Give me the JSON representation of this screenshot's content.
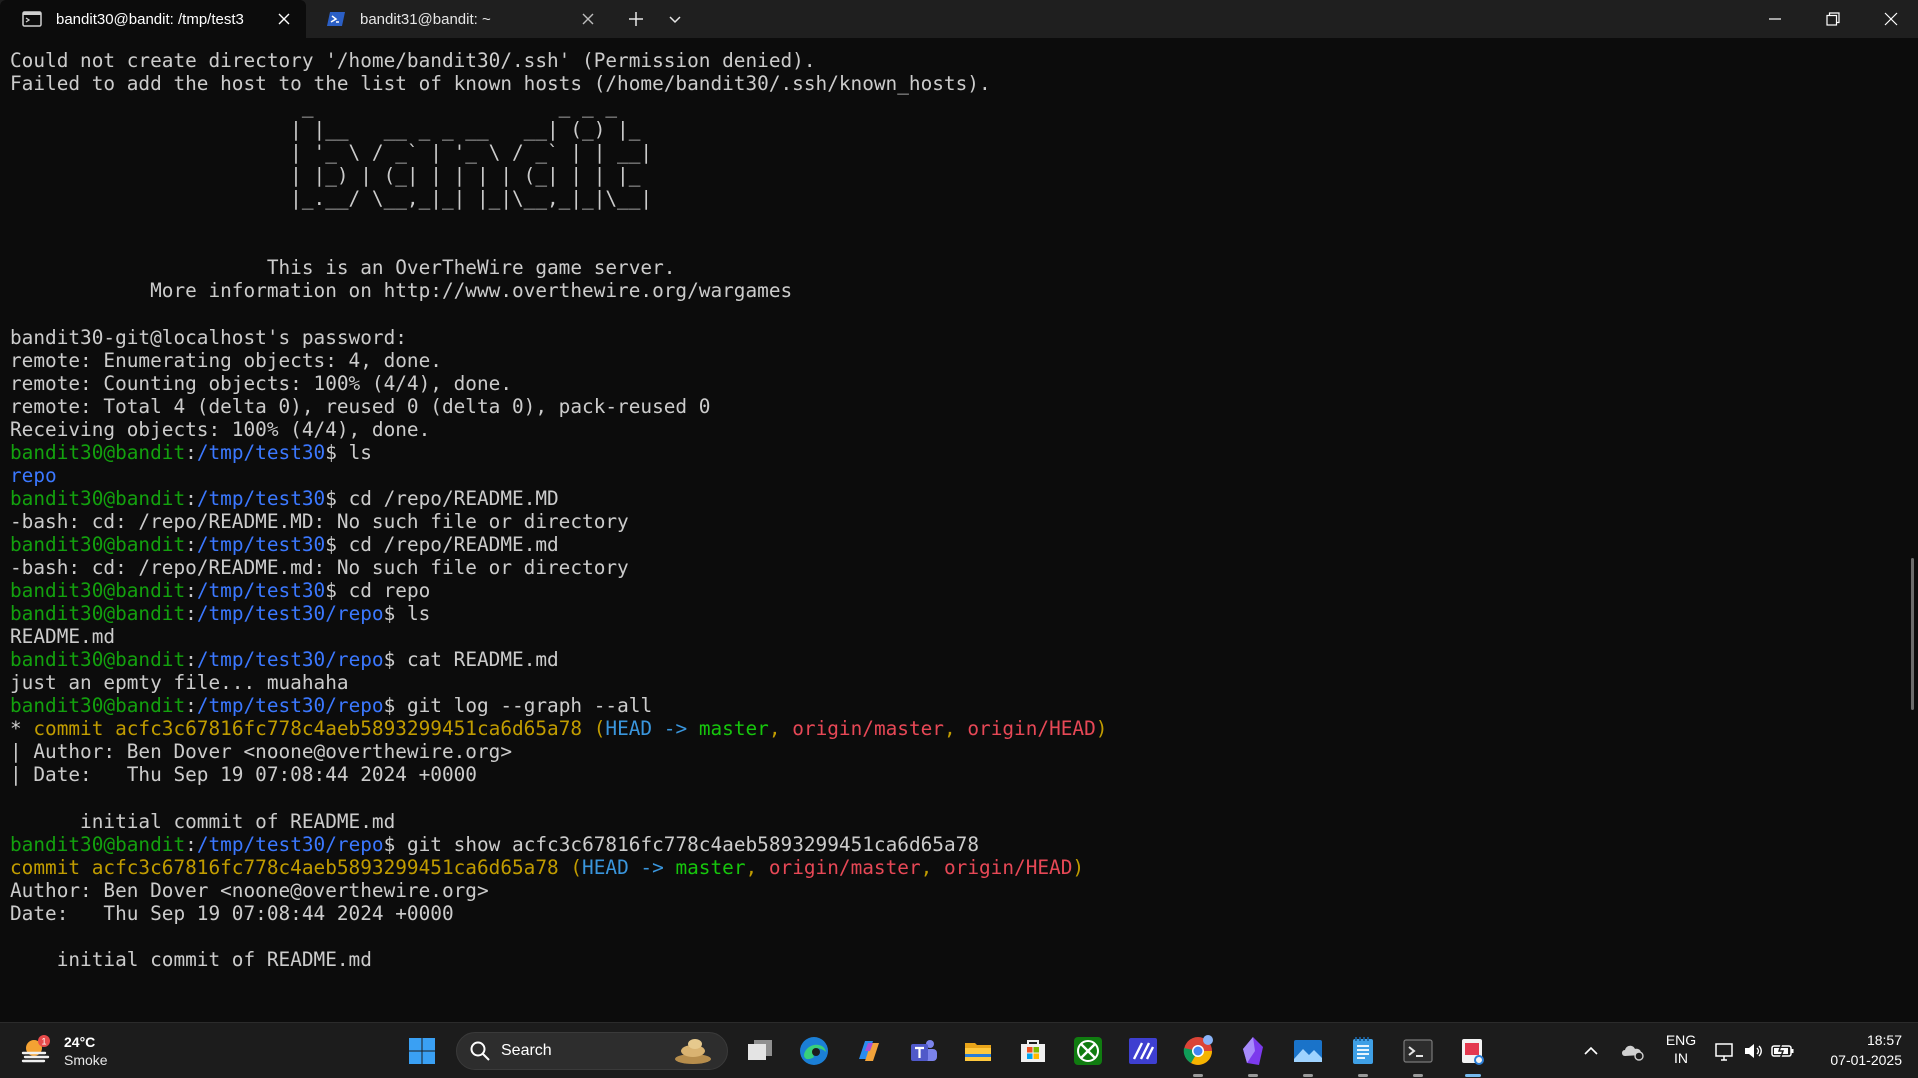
{
  "tabs": [
    {
      "title": "bandit30@bandit: /tmp/test3",
      "icon": "terminal-icon"
    },
    {
      "title": "bandit31@bandit: ~",
      "icon": "powershell-icon"
    }
  ],
  "terminal": {
    "lines": [
      [
        {
          "t": "Could not create directory '/home/bandit30/.ssh' (Permission denied)."
        }
      ],
      [
        {
          "t": "Failed to add the host to the list of known hosts (/home/bandit30/.ssh/known_hosts)."
        }
      ],
      [
        {
          "t": "                         _                     _ _ _   "
        }
      ],
      [
        {
          "t": "                        | |__   __ _ _ __   __| (_) |_ "
        }
      ],
      [
        {
          "t": "                        | '_ \\ / _` | '_ \\ / _` | | __|"
        }
      ],
      [
        {
          "t": "                        | |_) | (_| | | | | (_| | | |_ "
        }
      ],
      [
        {
          "t": "                        |_.__/ \\__,_|_| |_|\\__,_|_|\\__|"
        }
      ],
      [
        {
          "t": ""
        }
      ],
      [
        {
          "t": ""
        }
      ],
      [
        {
          "t": "                      This is an OverTheWire game server."
        }
      ],
      [
        {
          "t": "            More information on http://www.overthewire.org/wargames"
        }
      ],
      [
        {
          "t": ""
        }
      ],
      [
        {
          "t": "bandit30-git@localhost's password:"
        }
      ],
      [
        {
          "t": "remote: Enumerating objects: 4, done."
        }
      ],
      [
        {
          "t": "remote: Counting objects: 100% (4/4), done."
        }
      ],
      [
        {
          "t": "remote: Total 4 (delta 0), reused 0 (delta 0), pack-reused 0"
        }
      ],
      [
        {
          "t": "Receiving objects: 100% (4/4), done."
        }
      ],
      [
        {
          "t": "bandit30@bandit",
          "c": "green"
        },
        {
          "t": ":"
        },
        {
          "t": "/tmp/test30",
          "c": "blue"
        },
        {
          "t": "$ ls"
        }
      ],
      [
        {
          "t": "repo",
          "c": "blue"
        }
      ],
      [
        {
          "t": "bandit30@bandit",
          "c": "green"
        },
        {
          "t": ":"
        },
        {
          "t": "/tmp/test30",
          "c": "blue"
        },
        {
          "t": "$ cd /repo/README.MD"
        }
      ],
      [
        {
          "t": "-bash: cd: /repo/README.MD: No such file or directory"
        }
      ],
      [
        {
          "t": "bandit30@bandit",
          "c": "green"
        },
        {
          "t": ":"
        },
        {
          "t": "/tmp/test30",
          "c": "blue"
        },
        {
          "t": "$ cd /repo/README.md"
        }
      ],
      [
        {
          "t": "-bash: cd: /repo/README.md: No such file or directory"
        }
      ],
      [
        {
          "t": "bandit30@bandit",
          "c": "green"
        },
        {
          "t": ":"
        },
        {
          "t": "/tmp/test30",
          "c": "blue"
        },
        {
          "t": "$ cd repo"
        }
      ],
      [
        {
          "t": "bandit30@bandit",
          "c": "green"
        },
        {
          "t": ":"
        },
        {
          "t": "/tmp/test30/repo",
          "c": "blue"
        },
        {
          "t": "$ ls"
        }
      ],
      [
        {
          "t": "README.md"
        }
      ],
      [
        {
          "t": "bandit30@bandit",
          "c": "green"
        },
        {
          "t": ":"
        },
        {
          "t": "/tmp/test30/repo",
          "c": "blue"
        },
        {
          "t": "$ cat README.md"
        }
      ],
      [
        {
          "t": "just an epmty file... muahaha"
        }
      ],
      [
        {
          "t": "bandit30@bandit",
          "c": "green"
        },
        {
          "t": ":"
        },
        {
          "t": "/tmp/test30/repo",
          "c": "blue"
        },
        {
          "t": "$ git log --graph --all"
        }
      ],
      [
        {
          "t": "* "
        },
        {
          "t": "commit acfc3c67816fc778c4aeb5893299451ca6d65a78 (",
          "c": "yellow"
        },
        {
          "t": "HEAD -> ",
          "c": "cyan"
        },
        {
          "t": "master",
          "c": "lgreen"
        },
        {
          "t": ", ",
          "c": "yellow"
        },
        {
          "t": "origin/master",
          "c": "red"
        },
        {
          "t": ", ",
          "c": "yellow"
        },
        {
          "t": "origin/HEAD",
          "c": "red"
        },
        {
          "t": ")",
          "c": "yellow"
        }
      ],
      [
        {
          "t": "| Author: Ben Dover <noone@overthewire.org>"
        }
      ],
      [
        {
          "t": "| Date:   Thu Sep 19 07:08:44 2024 +0000"
        }
      ],
      [
        {
          "t": ""
        }
      ],
      [
        {
          "t": "      initial commit of README.md"
        }
      ],
      [
        {
          "t": "bandit30@bandit",
          "c": "green"
        },
        {
          "t": ":"
        },
        {
          "t": "/tmp/test30/repo",
          "c": "blue"
        },
        {
          "t": "$ git show acfc3c67816fc778c4aeb5893299451ca6d65a78"
        }
      ],
      [
        {
          "t": "commit acfc3c67816fc778c4aeb5893299451ca6d65a78 (",
          "c": "yellow"
        },
        {
          "t": "HEAD -> ",
          "c": "cyan"
        },
        {
          "t": "master",
          "c": "lgreen"
        },
        {
          "t": ", ",
          "c": "yellow"
        },
        {
          "t": "origin/master",
          "c": "red"
        },
        {
          "t": ", ",
          "c": "yellow"
        },
        {
          "t": "origin/HEAD",
          "c": "red"
        },
        {
          "t": ")",
          "c": "yellow"
        }
      ],
      [
        {
          "t": "Author: Ben Dover <noone@overthewire.org>"
        }
      ],
      [
        {
          "t": "Date:   Thu Sep 19 07:08:44 2024 +0000"
        }
      ],
      [
        {
          "t": ""
        }
      ],
      [
        {
          "t": "    initial commit of README.md"
        }
      ]
    ]
  },
  "taskbar": {
    "weather": {
      "temp": "24°C",
      "desc": "Smoke",
      "badge": "1"
    },
    "search_label": "Search",
    "apps": [
      "start-icon",
      "task-view-icon",
      "edge-icon",
      "copilot-icon",
      "teams-icon",
      "file-explorer-icon",
      "store-icon",
      "xbox-icon",
      "pen-app-icon",
      "chrome-icon",
      "obsidian-icon",
      "photos-icon",
      "notepad-icon",
      "terminal-icon",
      "snipping-tool-icon"
    ],
    "tray": {
      "lang": "ENG",
      "region": "IN",
      "time": "18:57",
      "date": "07-01-2025"
    }
  },
  "colors": {
    "terminal_bg": "#0c0c0c",
    "prompt_user": "#13a10e",
    "prompt_path": "#3b78ff",
    "commit": "#c19c00",
    "head": "#3a96dd",
    "branch": "#16c60c",
    "remote": "#e74856"
  }
}
